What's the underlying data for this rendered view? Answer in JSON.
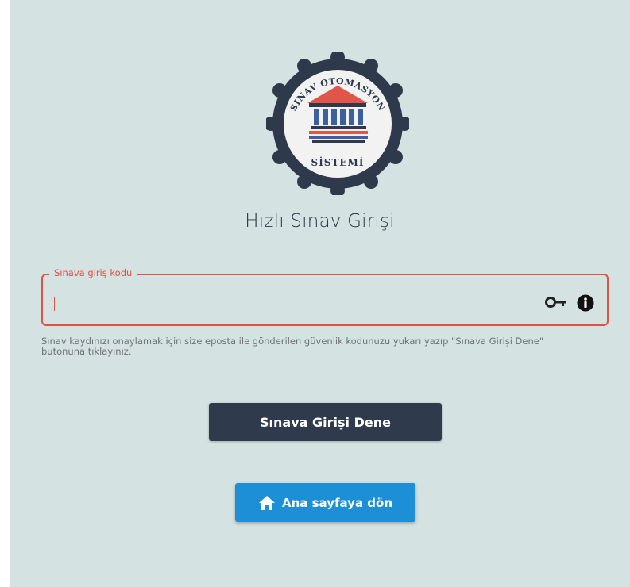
{
  "logo": {
    "arc_text": "SINAV OTOMASYON",
    "bottom_text": "SİSTEMİ"
  },
  "page": {
    "title": "Hızlı Sınav Girişi"
  },
  "code_field": {
    "label": "Sınava giriş kodu",
    "value": "",
    "help_text": "Sınav kaydınızı onaylamak için size eposta ile gönderilen güvenlik kodunuzu yukarı yazıp \"Sınava Girişi Dene\" butonuna tıklayınız.",
    "icons": [
      "key-icon",
      "info-icon"
    ]
  },
  "actions": {
    "submit_label": "Sınava Girişi Dene",
    "home_label": "Ana sayfaya dön",
    "home_icon": "home-icon"
  },
  "colors": {
    "background": "#d4e2e1",
    "error_accent": "#e15244",
    "primary_button": "#2f3a4d",
    "home_button": "#1d8fd6",
    "logo_dark": "#2e3a4c",
    "logo_red": "#e0574a",
    "logo_blue": "#3d5fa0"
  }
}
